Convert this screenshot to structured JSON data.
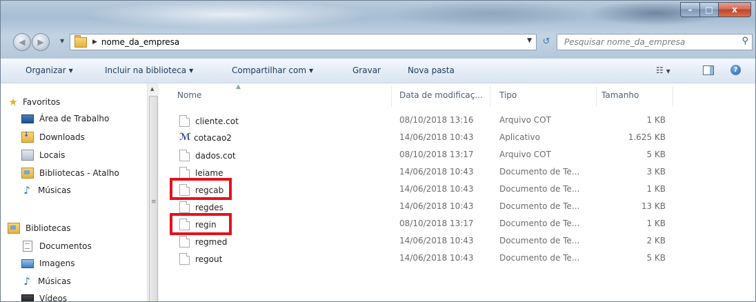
{
  "window": {
    "address": {
      "crumb": "nome_da_empresa"
    },
    "search": {
      "placeholder": "Pesquisar nome_da_empresa"
    },
    "caption": {
      "minimize": "–",
      "maximize": "□",
      "close": "x"
    }
  },
  "toolbar": {
    "organize": "Organizar",
    "include_library": "Incluir na biblioteca",
    "share": "Compartilhar com",
    "burn": "Gravar",
    "new_folder": "Nova pasta"
  },
  "nav_pane": {
    "favorites": {
      "label": "Favoritos",
      "items": [
        {
          "label": "Área de Trabalho",
          "icon": "desktop-icon"
        },
        {
          "label": "Downloads",
          "icon": "downloads-icon"
        },
        {
          "label": "Locais",
          "icon": "recent-places-icon"
        },
        {
          "label": "Bibliotecas - Atalho",
          "icon": "library-shortcut-icon"
        },
        {
          "label": "Músicas",
          "icon": "music-icon"
        }
      ]
    },
    "libraries": {
      "label": "Bibliotecas",
      "items": [
        {
          "label": "Documentos",
          "icon": "documents-icon"
        },
        {
          "label": "Imagens",
          "icon": "pictures-icon"
        },
        {
          "label": "Músicas",
          "icon": "music-icon"
        },
        {
          "label": "Vídeos",
          "icon": "videos-icon"
        }
      ]
    }
  },
  "columns": {
    "name": "Nome",
    "modified": "Data de modificaç...",
    "type": "Tipo",
    "size": "Tamanho"
  },
  "files": [
    {
      "name": "cliente.cot",
      "modified": "08/10/2018 13:16",
      "type": "Arquivo COT",
      "size": "1 KB",
      "icon": "file-icon"
    },
    {
      "name": "cotacao2",
      "modified": "14/06/2018 10:43",
      "type": "Aplicativo",
      "size": "1.625 KB",
      "icon": "application-icon"
    },
    {
      "name": "dados.cot",
      "modified": "08/10/2018 13:17",
      "type": "Arquivo COT",
      "size": "5 KB",
      "icon": "file-icon"
    },
    {
      "name": "leiame",
      "modified": "14/06/2018 10:43",
      "type": "Documento de Te...",
      "size": "3 KB",
      "icon": "text-file-icon"
    },
    {
      "name": "regcab",
      "modified": "14/06/2018 10:43",
      "type": "Documento de Te...",
      "size": "1 KB",
      "icon": "text-file-icon"
    },
    {
      "name": "regdes",
      "modified": "14/06/2018 10:43",
      "type": "Documento de Te...",
      "size": "13 KB",
      "icon": "text-file-icon"
    },
    {
      "name": "regin",
      "modified": "08/10/2018 13:17",
      "type": "Documento de Te...",
      "size": "1 KB",
      "icon": "text-file-icon"
    },
    {
      "name": "regmed",
      "modified": "14/06/2018 10:43",
      "type": "Documento de Te...",
      "size": "2 KB",
      "icon": "text-file-icon"
    },
    {
      "name": "regout",
      "modified": "14/06/2018 10:43",
      "type": "Documento de Te...",
      "size": "5 KB",
      "icon": "text-file-icon"
    }
  ],
  "highlight_color": "#e5101d"
}
